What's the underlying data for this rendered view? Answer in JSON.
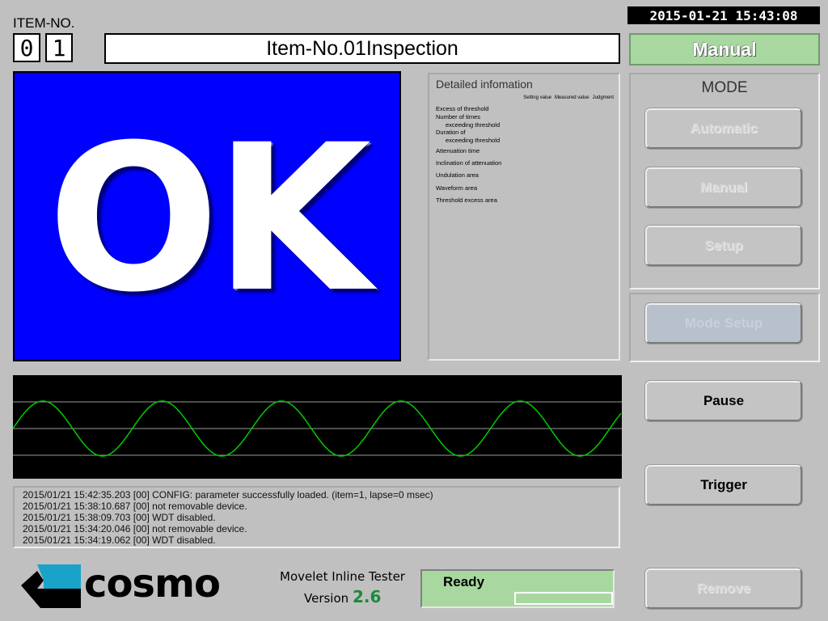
{
  "item": {
    "label": "ITEM-NO.",
    "digits": [
      "0",
      "1"
    ],
    "title": "Item-No.01Inspection"
  },
  "clock": "2015-01-21 15:43:08",
  "mode_badge": "Manual",
  "result": {
    "text": "OK",
    "bg_color": "#0000ff"
  },
  "detail": {
    "title": "Detailed infomation",
    "columns": [
      "Setting value",
      "Measured value",
      "Judgment"
    ],
    "items": [
      {
        "label": "Excess of threshold"
      },
      {
        "label": "Number of times"
      },
      {
        "label": "exceeding threshold"
      },
      {
        "label": "Duration of"
      },
      {
        "label": "exceeding threshold"
      },
      {
        "label": "Attenuation time"
      },
      {
        "label": "Inclination of attenuation"
      },
      {
        "label": "Undulation area"
      },
      {
        "label": "Waveform area"
      },
      {
        "label": "Threshold excess area"
      }
    ]
  },
  "mode": {
    "title": "MODE",
    "buttons": {
      "automatic": "Automatic",
      "manual": "Manual",
      "setup": "Setup",
      "mode_setup": "Mode Setup"
    }
  },
  "actions": {
    "pause": "Pause",
    "trigger": "Trigger",
    "remove": "Remove"
  },
  "waveform": {
    "line_color": "#00cc00",
    "grid_color": "#9a9a9a",
    "cycles": 5
  },
  "log": [
    "2015/01/21 15:42:35.203 [00] CONFIG: parameter successfully loaded. (item=1, lapse=0 msec)",
    "2015/01/21 15:38:10.687 [00] not removable device.",
    "2015/01/21 15:38:09.703 [00] WDT disabled.",
    "2015/01/21 15:34:20.046 [00] not removable device.",
    "2015/01/21 15:34:19.062 [00] WDT disabled."
  ],
  "footer": {
    "brand": "cosmo",
    "app_name": "Movelet Inline Tester",
    "version_label": "Version",
    "version_number": "2.6",
    "status": "Ready",
    "brand_color": "#1aa3c8",
    "status_color": "#a8d8a0"
  }
}
